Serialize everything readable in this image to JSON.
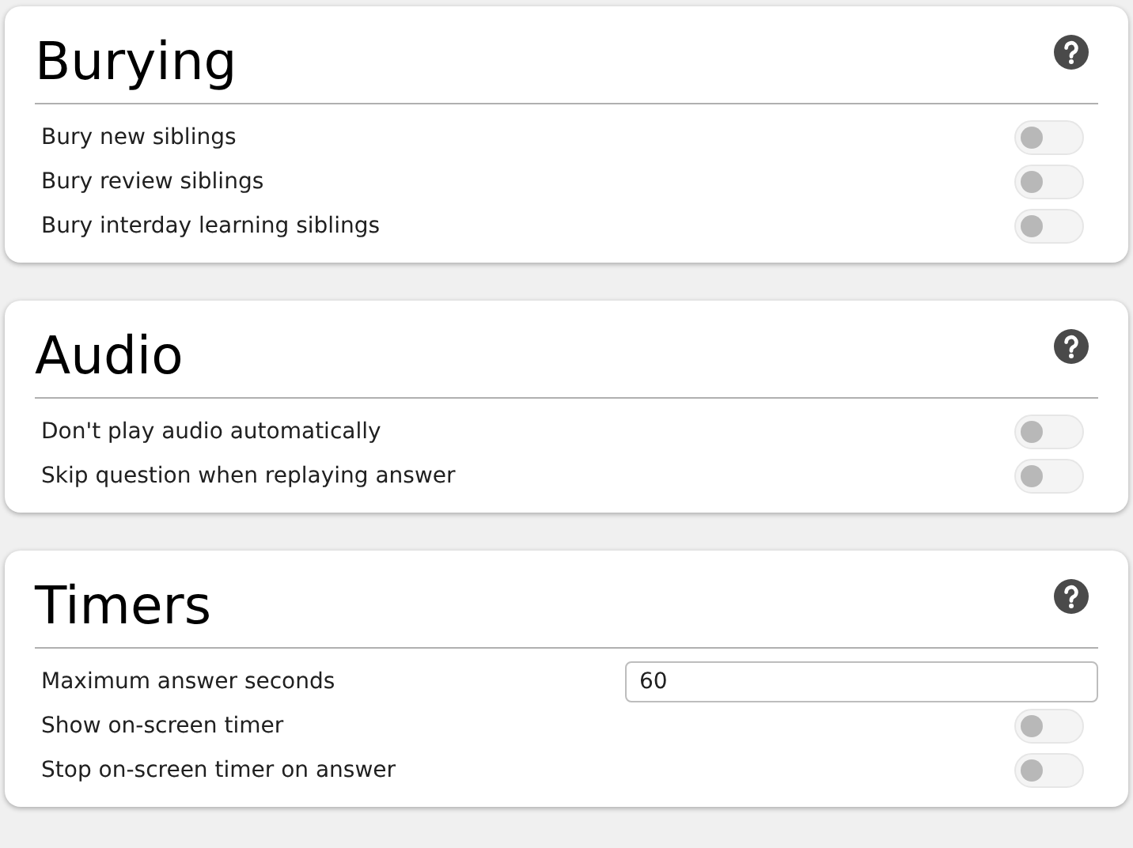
{
  "sections": [
    {
      "title": "Burying",
      "rows": [
        {
          "kind": "toggle",
          "label": "Bury new siblings",
          "on": false
        },
        {
          "kind": "toggle",
          "label": "Bury review siblings",
          "on": false
        },
        {
          "kind": "toggle",
          "label": "Bury interday learning siblings",
          "on": false
        }
      ]
    },
    {
      "title": "Audio",
      "rows": [
        {
          "kind": "toggle",
          "label": "Don't play audio automatically",
          "on": false
        },
        {
          "kind": "toggle",
          "label": "Skip question when replaying answer",
          "on": false
        }
      ]
    },
    {
      "title": "Timers",
      "rows": [
        {
          "kind": "number",
          "label": "Maximum answer seconds",
          "value": "60"
        },
        {
          "kind": "toggle",
          "label": "Show on-screen timer",
          "on": false
        },
        {
          "kind": "toggle",
          "label": "Stop on-screen timer on answer",
          "on": false
        }
      ]
    }
  ]
}
